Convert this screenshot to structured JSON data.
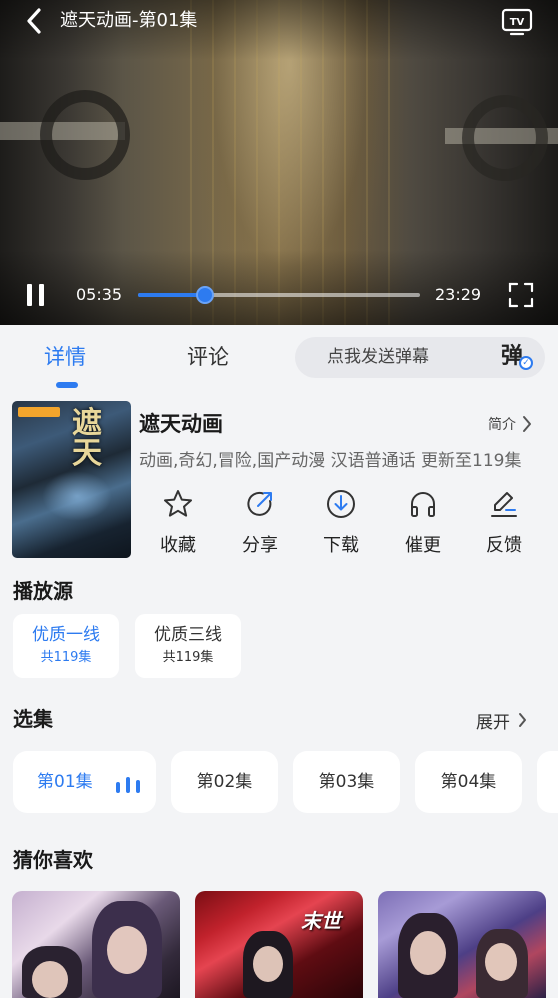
{
  "player": {
    "title": "遮天动画-第01集",
    "current_time": "05:35",
    "total_time": "23:29",
    "progress_percent": 23.8,
    "accent_color": "#2d7bf0",
    "icons": [
      "back-arrow-icon",
      "tv-cast-icon",
      "pause-icon",
      "fullscreen-icon"
    ]
  },
  "tabs": [
    {
      "label": "详情",
      "active": true
    },
    {
      "label": "评论",
      "active": false
    }
  ],
  "danmaku": {
    "placeholder": "点我发送弹幕",
    "toggle_label": "弹"
  },
  "show": {
    "title": "遮天动画",
    "intro_label": "简介",
    "meta": "动画,奇幻,冒险,国产动漫 汉语普通话 更新至119集",
    "poster_title": "遮天"
  },
  "actions": [
    {
      "label": "收藏",
      "icon": "star-icon"
    },
    {
      "label": "分享",
      "icon": "share-icon"
    },
    {
      "label": "下载",
      "icon": "download-icon"
    },
    {
      "label": "催更",
      "icon": "headphones-icon"
    },
    {
      "label": "反馈",
      "icon": "edit-icon"
    }
  ],
  "sources": {
    "title": "播放源",
    "items": [
      {
        "name": "优质一线",
        "count": "共119集",
        "active": true
      },
      {
        "name": "优质三线",
        "count": "共119集",
        "active": false
      }
    ]
  },
  "episodes": {
    "title": "选集",
    "expand_label": "展开",
    "items": [
      {
        "label": "第01集",
        "active": true
      },
      {
        "label": "第02集",
        "active": false
      },
      {
        "label": "第03集",
        "active": false
      },
      {
        "label": "第04集",
        "active": false
      }
    ]
  },
  "recommend": {
    "title": "猜你喜欢",
    "cards": [
      {
        "logo": ""
      },
      {
        "logo": "末世"
      },
      {
        "logo": ""
      }
    ]
  }
}
